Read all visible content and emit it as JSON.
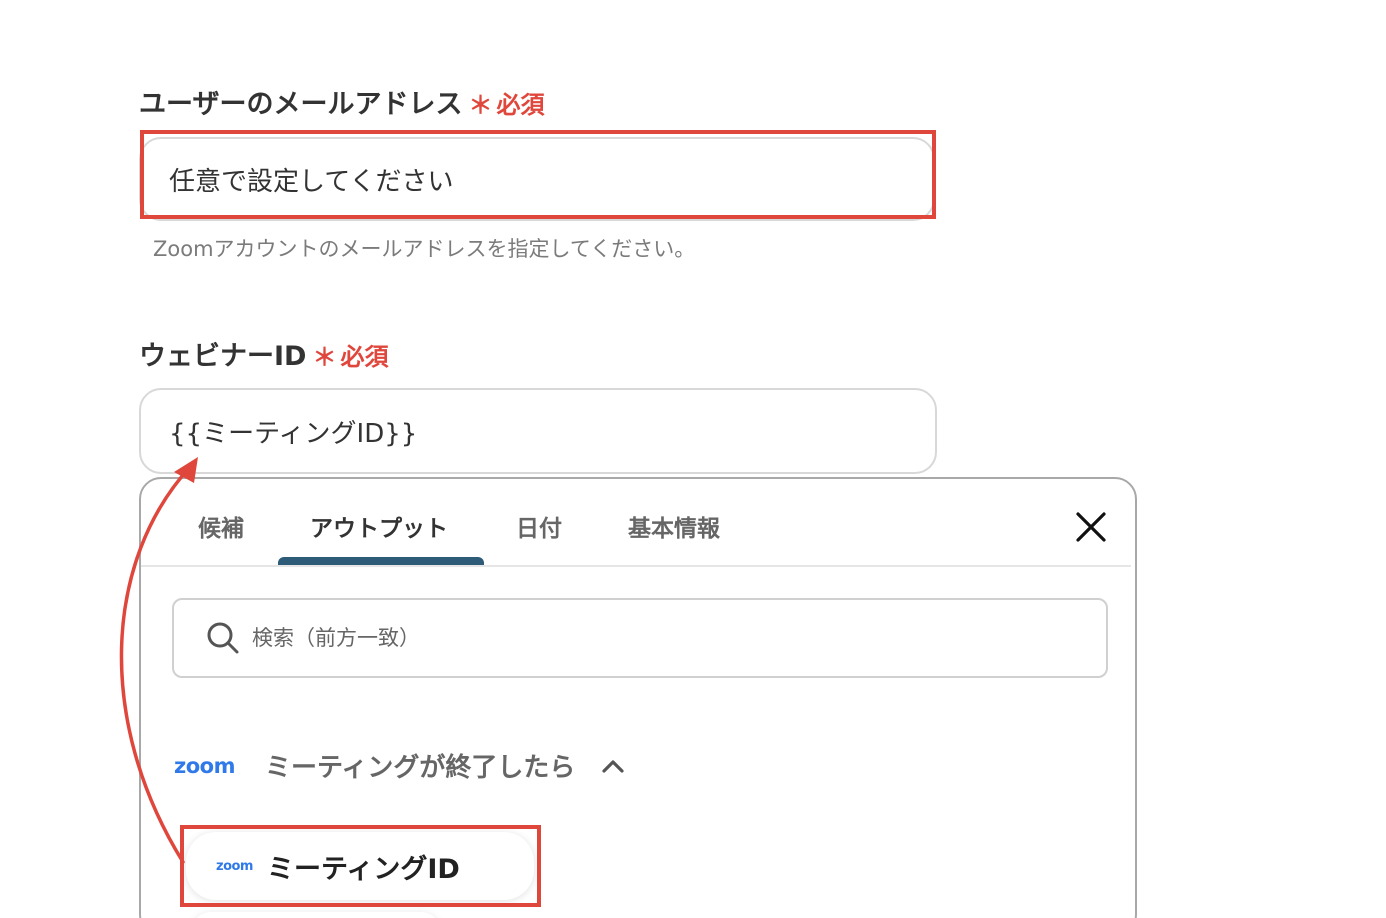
{
  "form": {
    "email_field": {
      "label": "ユーザーのメールアドレス",
      "required_mark": "＊",
      "required_text": "必須",
      "value": "任意で設定してください",
      "hint": "Zoomアカウントのメールアドレスを指定してください。"
    },
    "webinar_field": {
      "label": "ウェビナーID",
      "required_mark": "＊",
      "required_text": "必須",
      "value": "{{ミーティングID}}"
    }
  },
  "popover": {
    "tabs": [
      {
        "label": "候補"
      },
      {
        "label": "アウトプット",
        "active": true
      },
      {
        "label": "日付"
      },
      {
        "label": "基本情報"
      }
    ],
    "close_icon": "close-icon",
    "search": {
      "placeholder": "検索（前方一致）",
      "icon": "search-icon"
    },
    "group": {
      "app_logo": "zoom",
      "title": "ミーティングが終了したら",
      "expanded_icon": "chevron-up-icon"
    },
    "items": [
      {
        "app_logo": "zoom",
        "label": "ミーティングID"
      }
    ]
  },
  "colors": {
    "required": "#e0473c",
    "highlight": "#e0473c",
    "tab_underline": "#2d5b78",
    "zoom_blue": "#2f79e8"
  }
}
